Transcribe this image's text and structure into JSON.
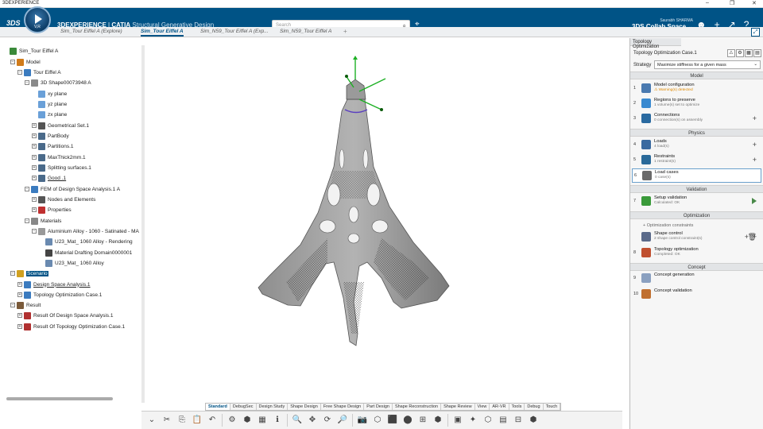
{
  "window": {
    "title": "3DEXPERIENCE",
    "controls": [
      "–",
      "❐",
      "✕"
    ]
  },
  "header": {
    "logo": "3DS",
    "compass_version": "V,R",
    "brand": "3DEXPERIENCE",
    "sep": " | ",
    "product": "CATIA",
    "app": "Structural Generative Design",
    "search_placeholder": "Search",
    "user_name": "Saurabh SHARMA",
    "space": "3DS Collab Space ⌄"
  },
  "tabs": [
    {
      "label": "Sim_Tour Eiffel A (Explore)",
      "active": false
    },
    {
      "label": "Sim_Tour Eiffel A",
      "active": true
    },
    {
      "label": "Sim_N59_Tour Eiffel A (Exp...",
      "active": false
    },
    {
      "label": "Sim_N59_Tour Eiffel A",
      "active": false
    }
  ],
  "tab_add": "+",
  "tree": [
    {
      "label": "Sim_Tour Eiffel A",
      "indent": 0,
      "pm": "",
      "color": "#3a8a3a",
      "style": ""
    },
    {
      "label": "Model",
      "indent": 1,
      "pm": "−",
      "color": "#d07b1a",
      "style": ""
    },
    {
      "label": "Tour Eiffel A",
      "indent": 2,
      "pm": "−",
      "color": "#3b7bbf",
      "style": ""
    },
    {
      "label": "3D Shape00073948 A",
      "indent": 3,
      "pm": "−",
      "color": "#8a8a8a",
      "style": ""
    },
    {
      "label": "xy plane",
      "indent": 4,
      "pm": "",
      "color": "#6aa0d8",
      "style": ""
    },
    {
      "label": "yz plane",
      "indent": 4,
      "pm": "",
      "color": "#6aa0d8",
      "style": ""
    },
    {
      "label": "zx plane",
      "indent": 4,
      "pm": "",
      "color": "#6aa0d8",
      "style": ""
    },
    {
      "label": "Geometrical Set.1",
      "indent": 4,
      "pm": "+",
      "color": "#555",
      "style": ""
    },
    {
      "label": "PartBody",
      "indent": 4,
      "pm": "+",
      "color": "#4a6a8a",
      "style": ""
    },
    {
      "label": "Partitions.1",
      "indent": 4,
      "pm": "+",
      "color": "#4a6a8a",
      "style": ""
    },
    {
      "label": "MaxThick2mm.1",
      "indent": 4,
      "pm": "+",
      "color": "#4a6a8a",
      "style": ""
    },
    {
      "label": "Splitting surfaces.1",
      "indent": 4,
      "pm": "+",
      "color": "#4a6a8a",
      "style": ""
    },
    {
      "label": "Good .1",
      "indent": 4,
      "pm": "+",
      "color": "#4a6a8a",
      "style": "ul"
    },
    {
      "label": "FEM of Design Space Analysis.1 A",
      "indent": 3,
      "pm": "−",
      "color": "#3b7bbf",
      "style": ""
    },
    {
      "label": "Nodes and Elements",
      "indent": 4,
      "pm": "+",
      "color": "#555",
      "style": ""
    },
    {
      "label": "Properties",
      "indent": 4,
      "pm": "+",
      "color": "#c03030",
      "style": ""
    },
    {
      "label": "Materials",
      "indent": 3,
      "pm": "−",
      "color": "#888",
      "style": ""
    },
    {
      "label": "Aluminium Alloy - 1060 - Satinated - MA",
      "indent": 4,
      "pm": "−",
      "color": "#999",
      "style": ""
    },
    {
      "label": "U23_Mat_ 1060 Alloy - Rendering",
      "indent": 5,
      "pm": "",
      "color": "#6a8ab0",
      "style": ""
    },
    {
      "label": "Material Drafting Domain0000001",
      "indent": 5,
      "pm": "",
      "color": "#444",
      "style": ""
    },
    {
      "label": "U23_Mat_ 1060 Alloy",
      "indent": 5,
      "pm": "",
      "color": "#6a8ab0",
      "style": ""
    },
    {
      "label": "Scenario",
      "indent": 1,
      "pm": "−",
      "color": "#d0a020",
      "style": "sel"
    },
    {
      "label": "Design Space Analysis.1",
      "indent": 2,
      "pm": "+",
      "color": "#3b7bbf",
      "style": "ul"
    },
    {
      "label": "Topology Optimization Case.1",
      "indent": 2,
      "pm": "+",
      "color": "#3b7bbf",
      "style": ""
    },
    {
      "label": "Result",
      "indent": 1,
      "pm": "−",
      "color": "#7a5a3a",
      "style": ""
    },
    {
      "label": "Result Of Design Space Analysis.1",
      "indent": 2,
      "pm": "+",
      "color": "#b03030",
      "style": ""
    },
    {
      "label": "Result Of Topology Optimization Case.1",
      "indent": 2,
      "pm": "+",
      "color": "#b03030",
      "style": ""
    }
  ],
  "toolbar_tabs": [
    {
      "label": "Standard",
      "active": true
    },
    {
      "label": "DebugSec",
      "active": false
    },
    {
      "label": "Design Study",
      "active": false
    },
    {
      "label": "Shape Design",
      "active": false
    },
    {
      "label": "Free Shape Design",
      "active": false
    },
    {
      "label": "Part Design",
      "active": false
    },
    {
      "label": "Shape Reconstruction",
      "active": false
    },
    {
      "label": "Shape Review",
      "active": false
    },
    {
      "label": "View",
      "active": false
    },
    {
      "label": "AR-VR",
      "active": false
    },
    {
      "label": "Tools",
      "active": false
    },
    {
      "label": "Debug",
      "active": false
    },
    {
      "label": "Touch",
      "active": false
    }
  ],
  "toolbar_icons": [
    "✂",
    "⎘",
    "📋",
    "↶",
    "⚙",
    "⬢",
    "▦",
    "ℹ",
    "🔍",
    "✥",
    "⟳",
    "🔎",
    "📷",
    "⬡",
    "⬛",
    "⬤",
    "⊞",
    "⬢",
    "▣",
    "✦",
    "⬡",
    "▤",
    "⊟",
    "⬢"
  ],
  "panel": {
    "title": "Topology Optimization",
    "case": "Topology Optimization Case.1",
    "strategy_label": "Strategy",
    "strategy_value": "Maximize stiffness for a given mass",
    "sections": {
      "model": "Model",
      "physics": "Physics",
      "validation": "Validation",
      "optimization": "Optimization",
      "concept": "Concept"
    },
    "steps": [
      {
        "num": "1",
        "title": "Model configuration",
        "sub": "⚠ Warning(s) detected",
        "warn": true,
        "plus": false
      },
      {
        "num": "2",
        "title": "Regions to preserve",
        "sub": "1 volume(s) set to optimize",
        "warn": false,
        "plus": false
      },
      {
        "num": "3",
        "title": "Connections",
        "sub": "0 connection(s) on assembly",
        "warn": false,
        "plus": true
      },
      {
        "num": "4",
        "title": "Loads",
        "sub": "4 load(s)",
        "warn": false,
        "plus": true
      },
      {
        "num": "5",
        "title": "Restraints",
        "sub": "1 restraint(s)",
        "warn": false,
        "plus": true
      },
      {
        "num": "6",
        "title": "Load cases",
        "sub": "0 case(s)",
        "warn": false,
        "plus": false
      },
      {
        "num": "7",
        "title": "Setup validation",
        "sub": "Calculated: OK",
        "warn": false,
        "plus": false
      },
      {
        "num": "",
        "title": "Shape control",
        "sub": "2 shape control constraint(s)",
        "warn": false,
        "plus": true
      },
      {
        "num": "8",
        "title": "Topology optimization",
        "sub": "Completed: OK",
        "warn": false,
        "plus": false
      },
      {
        "num": "9",
        "title": "Concept generation",
        "sub": "",
        "warn": false,
        "plus": false
      },
      {
        "num": "10",
        "title": "Concept validation",
        "sub": "",
        "warn": false,
        "plus": false
      }
    ],
    "opt_constraints": "+ Optimization constraints"
  }
}
